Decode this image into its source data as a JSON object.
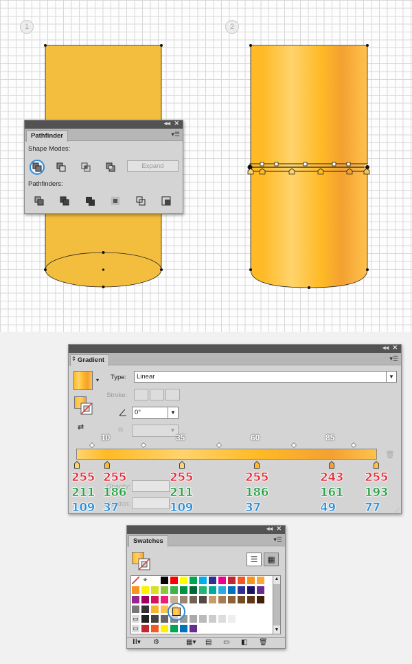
{
  "steps": [
    "1",
    "2"
  ],
  "colors": {
    "fill_base": "#f3bd3e",
    "grad_light": "#ffd36d",
    "grad_dark": "#f4a525",
    "accent_ring": "#2d8bd6"
  },
  "pathfinder": {
    "tab": "Pathfinder",
    "shape_modes_label": "Shape Modes:",
    "expand_label": "Expand",
    "pathfinders_label": "Pathfinders:",
    "shape_mode_icons": [
      "unite-icon",
      "minus-front-icon",
      "intersect-icon",
      "exclude-icon"
    ],
    "pathfinder_icons": [
      "divide-icon",
      "trim-icon",
      "merge-icon",
      "crop-icon",
      "outline-icon",
      "minus-back-icon"
    ]
  },
  "gradient": {
    "tab": "Gradient",
    "type_label": "Type:",
    "type_value": "Linear",
    "stroke_label": "Stroke:",
    "angle_value": "0°",
    "location_label": "Location:",
    "opacity_label": "Opacity:",
    "midpoints": [
      "10",
      "35",
      "60",
      "85"
    ],
    "stops": [
      {
        "r": "255",
        "g": "211",
        "b": "109"
      },
      {
        "r": "255",
        "g": "186",
        "b": "37"
      },
      {
        "r": "255",
        "g": "211",
        "b": "109"
      },
      {
        "r": "255",
        "g": "186",
        "b": "37"
      },
      {
        "r": "243",
        "g": "161",
        "b": "49"
      },
      {
        "r": "255",
        "g": "193",
        "b": "77"
      }
    ]
  },
  "swatches": {
    "tab": "Swatches",
    "view_icons": [
      "list-view-icon",
      "grid-view-icon"
    ],
    "footer_icons": [
      "library-menu-icon",
      "show-kinds-icon",
      "swatch-options-icon",
      "new-color-group-icon",
      "new-swatch-icon",
      "delete-swatch-icon"
    ]
  }
}
